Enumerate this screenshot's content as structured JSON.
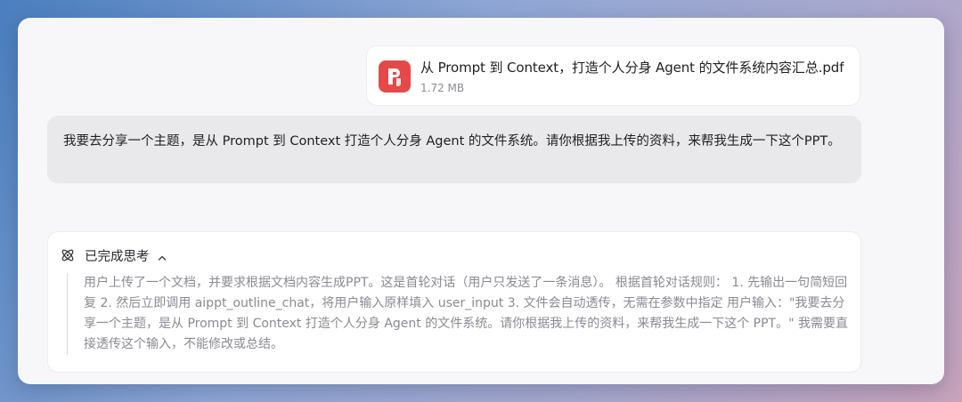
{
  "attachment": {
    "file_name": "从 Prompt 到 Context，打造个人分身 Agent 的文件系统内容汇总.pdf",
    "file_size": "1.72 MB",
    "icon": "pdf-file-icon",
    "icon_color": "#e54848"
  },
  "user_message": {
    "text": "我要去分享一个主题，是从 Prompt 到 Context 打造个人分身 Agent 的文件系统。请你根据我上传的资料，来帮我生成一下这个PPT。"
  },
  "thinking": {
    "title": "已完成思考",
    "icon": "atom-icon",
    "toggle_icon": "chevron-up-icon",
    "content": "用户上传了一个文档，并要求根据文档内容生成PPT。这是首轮对话（用户只发送了一条消息）。 根据首轮对话规则： 1. 先输出一句简短回复 2. 然后立即调用 aippt_outline_chat，将用户输入原样填入 user_input 3. 文件会自动透传，无需在参数中指定 用户输入：\"我要去分享一个主题，是从 Prompt 到 Context 打造个人分身 Agent 的文件系统。请你根据我上传的资料，来帮我生成一下这个 PPT。\" 我需要直接透传这个输入，不能修改或总结。"
  }
}
